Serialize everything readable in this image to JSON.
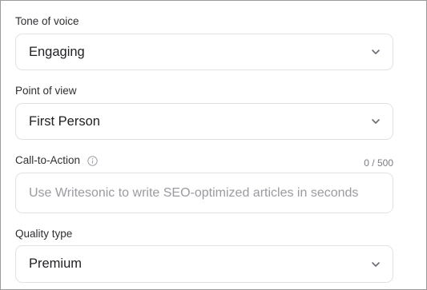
{
  "form": {
    "tone": {
      "label": "Tone of voice",
      "value": "Engaging"
    },
    "point_of_view": {
      "label": "Point of view",
      "value": "First Person"
    },
    "cta": {
      "label": "Call-to-Action",
      "counter": "0 / 500",
      "placeholder": "Use Writesonic to write SEO-optimized articles in seconds"
    },
    "quality": {
      "label": "Quality type",
      "value": "Premium"
    }
  },
  "icons": {
    "dropdown": "chevron-down-icon",
    "info": "info-icon"
  },
  "colors": {
    "border": "#e2e2e6",
    "text": "#1f1f23",
    "placeholder": "#9a9aa0"
  }
}
